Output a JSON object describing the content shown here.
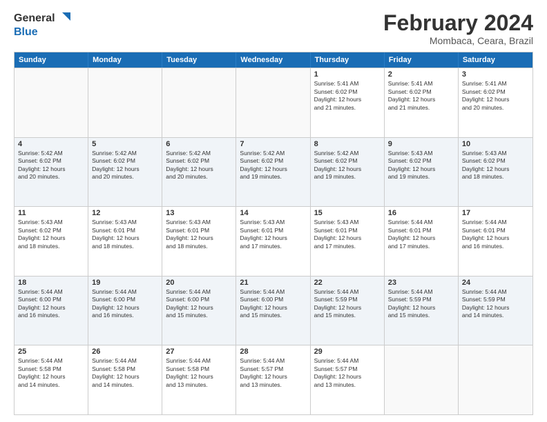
{
  "header": {
    "logo_general": "General",
    "logo_blue": "Blue",
    "main_title": "February 2024",
    "subtitle": "Mombaca, Ceara, Brazil"
  },
  "days_of_week": [
    "Sunday",
    "Monday",
    "Tuesday",
    "Wednesday",
    "Thursday",
    "Friday",
    "Saturday"
  ],
  "weeks": [
    [
      {
        "day": "",
        "info": ""
      },
      {
        "day": "",
        "info": ""
      },
      {
        "day": "",
        "info": ""
      },
      {
        "day": "",
        "info": ""
      },
      {
        "day": "1",
        "info": "Sunrise: 5:41 AM\nSunset: 6:02 PM\nDaylight: 12 hours\nand 21 minutes."
      },
      {
        "day": "2",
        "info": "Sunrise: 5:41 AM\nSunset: 6:02 PM\nDaylight: 12 hours\nand 21 minutes."
      },
      {
        "day": "3",
        "info": "Sunrise: 5:41 AM\nSunset: 6:02 PM\nDaylight: 12 hours\nand 20 minutes."
      }
    ],
    [
      {
        "day": "4",
        "info": "Sunrise: 5:42 AM\nSunset: 6:02 PM\nDaylight: 12 hours\nand 20 minutes."
      },
      {
        "day": "5",
        "info": "Sunrise: 5:42 AM\nSunset: 6:02 PM\nDaylight: 12 hours\nand 20 minutes."
      },
      {
        "day": "6",
        "info": "Sunrise: 5:42 AM\nSunset: 6:02 PM\nDaylight: 12 hours\nand 20 minutes."
      },
      {
        "day": "7",
        "info": "Sunrise: 5:42 AM\nSunset: 6:02 PM\nDaylight: 12 hours\nand 19 minutes."
      },
      {
        "day": "8",
        "info": "Sunrise: 5:42 AM\nSunset: 6:02 PM\nDaylight: 12 hours\nand 19 minutes."
      },
      {
        "day": "9",
        "info": "Sunrise: 5:43 AM\nSunset: 6:02 PM\nDaylight: 12 hours\nand 19 minutes."
      },
      {
        "day": "10",
        "info": "Sunrise: 5:43 AM\nSunset: 6:02 PM\nDaylight: 12 hours\nand 18 minutes."
      }
    ],
    [
      {
        "day": "11",
        "info": "Sunrise: 5:43 AM\nSunset: 6:02 PM\nDaylight: 12 hours\nand 18 minutes."
      },
      {
        "day": "12",
        "info": "Sunrise: 5:43 AM\nSunset: 6:01 PM\nDaylight: 12 hours\nand 18 minutes."
      },
      {
        "day": "13",
        "info": "Sunrise: 5:43 AM\nSunset: 6:01 PM\nDaylight: 12 hours\nand 18 minutes."
      },
      {
        "day": "14",
        "info": "Sunrise: 5:43 AM\nSunset: 6:01 PM\nDaylight: 12 hours\nand 17 minutes."
      },
      {
        "day": "15",
        "info": "Sunrise: 5:43 AM\nSunset: 6:01 PM\nDaylight: 12 hours\nand 17 minutes."
      },
      {
        "day": "16",
        "info": "Sunrise: 5:44 AM\nSunset: 6:01 PM\nDaylight: 12 hours\nand 17 minutes."
      },
      {
        "day": "17",
        "info": "Sunrise: 5:44 AM\nSunset: 6:01 PM\nDaylight: 12 hours\nand 16 minutes."
      }
    ],
    [
      {
        "day": "18",
        "info": "Sunrise: 5:44 AM\nSunset: 6:00 PM\nDaylight: 12 hours\nand 16 minutes."
      },
      {
        "day": "19",
        "info": "Sunrise: 5:44 AM\nSunset: 6:00 PM\nDaylight: 12 hours\nand 16 minutes."
      },
      {
        "day": "20",
        "info": "Sunrise: 5:44 AM\nSunset: 6:00 PM\nDaylight: 12 hours\nand 15 minutes."
      },
      {
        "day": "21",
        "info": "Sunrise: 5:44 AM\nSunset: 6:00 PM\nDaylight: 12 hours\nand 15 minutes."
      },
      {
        "day": "22",
        "info": "Sunrise: 5:44 AM\nSunset: 5:59 PM\nDaylight: 12 hours\nand 15 minutes."
      },
      {
        "day": "23",
        "info": "Sunrise: 5:44 AM\nSunset: 5:59 PM\nDaylight: 12 hours\nand 15 minutes."
      },
      {
        "day": "24",
        "info": "Sunrise: 5:44 AM\nSunset: 5:59 PM\nDaylight: 12 hours\nand 14 minutes."
      }
    ],
    [
      {
        "day": "25",
        "info": "Sunrise: 5:44 AM\nSunset: 5:58 PM\nDaylight: 12 hours\nand 14 minutes."
      },
      {
        "day": "26",
        "info": "Sunrise: 5:44 AM\nSunset: 5:58 PM\nDaylight: 12 hours\nand 14 minutes."
      },
      {
        "day": "27",
        "info": "Sunrise: 5:44 AM\nSunset: 5:58 PM\nDaylight: 12 hours\nand 13 minutes."
      },
      {
        "day": "28",
        "info": "Sunrise: 5:44 AM\nSunset: 5:57 PM\nDaylight: 12 hours\nand 13 minutes."
      },
      {
        "day": "29",
        "info": "Sunrise: 5:44 AM\nSunset: 5:57 PM\nDaylight: 12 hours\nand 13 minutes."
      },
      {
        "day": "",
        "info": ""
      },
      {
        "day": "",
        "info": ""
      }
    ]
  ]
}
